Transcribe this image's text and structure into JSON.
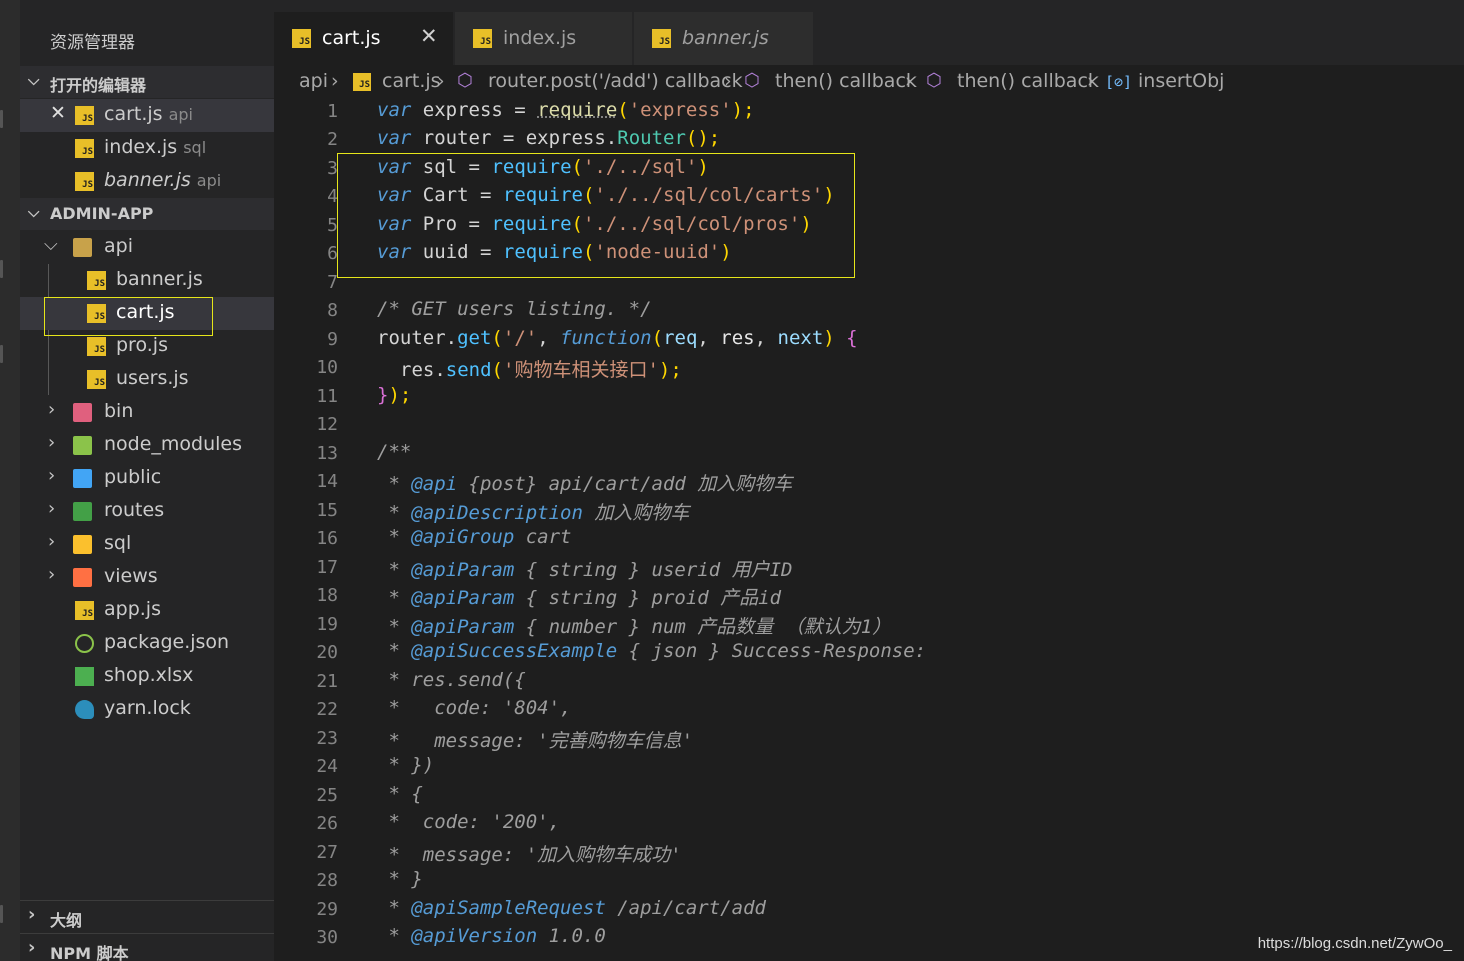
{
  "sidebar": {
    "title": "资源管理器",
    "open_editors_label": "打开的编辑器",
    "open_editors": [
      {
        "name": "cart.js",
        "hint": "api"
      },
      {
        "name": "index.js",
        "hint": "sql"
      },
      {
        "name": "banner.js",
        "hint": "api"
      }
    ],
    "project_label": "ADMIN-APP",
    "tree": [
      {
        "name": "api"
      },
      {
        "name": "banner.js"
      },
      {
        "name": "cart.js"
      },
      {
        "name": "pro.js"
      },
      {
        "name": "users.js"
      },
      {
        "name": "bin"
      },
      {
        "name": "node_modules"
      },
      {
        "name": "public"
      },
      {
        "name": "routes"
      },
      {
        "name": "sql"
      },
      {
        "name": "views"
      },
      {
        "name": "app.js"
      },
      {
        "name": "package.json"
      },
      {
        "name": "shop.xlsx"
      },
      {
        "name": "yarn.lock"
      }
    ],
    "outline_label": "大纲",
    "npm_label": "NPM 脚本"
  },
  "tabs": [
    {
      "label": "cart.js"
    },
    {
      "label": "index.js"
    },
    {
      "label": "banner.js"
    }
  ],
  "breadcrumb": [
    "api",
    "cart.js",
    "router.post('/add') callback",
    "then() callback",
    "then() callback",
    "insertObj"
  ],
  "line_numbers": [
    "1",
    "2",
    "3",
    "4",
    "5",
    "6",
    "7",
    "8",
    "9",
    "10",
    "11",
    "12",
    "13",
    "14",
    "15",
    "16",
    "17",
    "18",
    "19",
    "20",
    "21",
    "22",
    "23",
    "24",
    "25",
    "26",
    "27",
    "28",
    "29",
    "30"
  ],
  "code": {
    "l1": [
      "var",
      " express ",
      "=",
      " ",
      "require",
      "(",
      "'express'",
      ");"
    ],
    "l2": [
      "var",
      " router ",
      "=",
      " express.",
      "Router",
      "();"
    ],
    "l3": [
      "var",
      " sql ",
      "=",
      " ",
      "require",
      "(",
      "'./../sql'",
      ")"
    ],
    "l4": [
      "var",
      " Cart ",
      "=",
      " ",
      "require",
      "(",
      "'./../sql/col/carts'",
      ")"
    ],
    "l5": [
      "var",
      " Pro ",
      "=",
      " ",
      "require",
      "(",
      "'./../sql/col/pros'",
      ")"
    ],
    "l6": [
      "var",
      " uuid ",
      "=",
      " ",
      "require",
      "(",
      "'node-uuid'",
      ")"
    ],
    "l8": "/* GET users listing. */",
    "l9": [
      "router",
      ".",
      "get",
      "(",
      "'/'",
      ", ",
      "function",
      "(",
      "req",
      ", ",
      "res",
      ", ",
      "next",
      ") ",
      "{"
    ],
    "l10": [
      "res",
      ".",
      "send",
      "(",
      "'购物车相关接口'",
      ");"
    ],
    "l11": [
      "}",
      ");"
    ],
    "l13": "/**",
    "l14": [
      " * ",
      "@api",
      " {post} api/cart/add 加入购物车"
    ],
    "l15": [
      " * ",
      "@apiDescription",
      " 加入购物车"
    ],
    "l16": [
      " * ",
      "@apiGroup",
      " cart"
    ],
    "l17": [
      " * ",
      "@apiParam",
      " { string } userid 用户ID"
    ],
    "l18": [
      " * ",
      "@apiParam",
      " { string } proid 产品id"
    ],
    "l19": [
      " * ",
      "@apiParam",
      " { number } num 产品数量 （默认为1）"
    ],
    "l20": [
      " * ",
      "@apiSuccessExample",
      " { json } Success-Response:"
    ],
    "l21": " * res.send({",
    "l22": " *   code: '804',",
    "l23": " *   message: '完善购物车信息'",
    "l24": " * })",
    "l25": " * {",
    "l26": " *  code: '200',",
    "l27": " *  message: '加入购物车成功'",
    "l28": " * }",
    "l29": [
      " * ",
      "@apiSampleRequest",
      " /api/cart/add"
    ],
    "l30": [
      " * ",
      "@apiVersion",
      " 1.0.0"
    ]
  },
  "watermark": "https://blog.csdn.net/ZywOo_",
  "colors": {
    "highlight_box": "#e6e61a",
    "js_icon": "#e8bf28"
  }
}
